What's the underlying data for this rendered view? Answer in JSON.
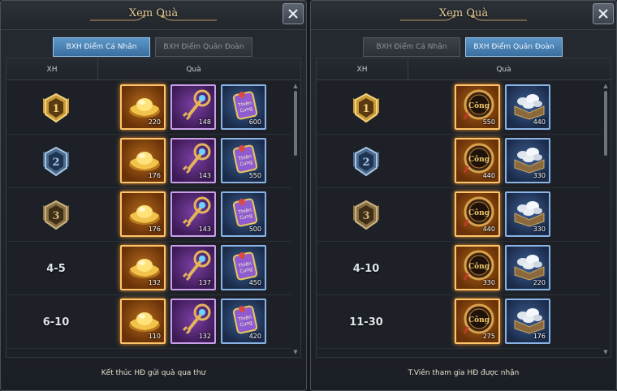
{
  "left": {
    "title": "Xem Quà",
    "tabs": [
      "BXH Điểm Cá Nhân",
      "BXH Điểm Quân Đoàn"
    ],
    "active_tab": 0,
    "columns": {
      "rank": "XH",
      "rewards": "Quà"
    },
    "rows": [
      {
        "rank": "1",
        "rank_type": "gold-badge",
        "items": [
          {
            "icon": "gold-ingot-icon",
            "qty": "220"
          },
          {
            "icon": "gem-key-icon",
            "qty": "148"
          },
          {
            "icon": "thien-cung-ticket-icon",
            "qty": "600"
          }
        ]
      },
      {
        "rank": "2",
        "rank_type": "silver-badge",
        "items": [
          {
            "icon": "gold-ingot-icon",
            "qty": "176"
          },
          {
            "icon": "gem-key-icon",
            "qty": "143"
          },
          {
            "icon": "thien-cung-ticket-icon",
            "qty": "550"
          }
        ]
      },
      {
        "rank": "3",
        "rank_type": "bronze-badge",
        "items": [
          {
            "icon": "gold-ingot-icon",
            "qty": "176"
          },
          {
            "icon": "gem-key-icon",
            "qty": "143"
          },
          {
            "icon": "thien-cung-ticket-icon",
            "qty": "500"
          }
        ]
      },
      {
        "rank": "4-5",
        "rank_type": "text",
        "items": [
          {
            "icon": "gold-ingot-icon",
            "qty": "132"
          },
          {
            "icon": "gem-key-icon",
            "qty": "137"
          },
          {
            "icon": "thien-cung-ticket-icon",
            "qty": "450"
          }
        ]
      },
      {
        "rank": "6-10",
        "rank_type": "text",
        "items": [
          {
            "icon": "gold-ingot-icon",
            "qty": "110"
          },
          {
            "icon": "gem-key-icon",
            "qty": "132"
          },
          {
            "icon": "thien-cung-ticket-icon",
            "qty": "420"
          }
        ]
      }
    ],
    "footer": "Kết thúc HĐ gửi quà qua thư"
  },
  "right": {
    "title": "Xem Quà",
    "tabs": [
      "BXH Điểm Cá Nhân",
      "BXH Điểm Quân Đoàn"
    ],
    "active_tab": 1,
    "columns": {
      "rank": "XH",
      "rewards": "Quà"
    },
    "rows": [
      {
        "rank": "1",
        "rank_type": "gold-badge",
        "items": [
          {
            "icon": "cong-medal-icon",
            "qty": "550"
          },
          {
            "icon": "silver-crate-icon",
            "qty": "440"
          }
        ]
      },
      {
        "rank": "2",
        "rank_type": "silver-badge",
        "items": [
          {
            "icon": "cong-medal-icon",
            "qty": "440"
          },
          {
            "icon": "silver-crate-icon",
            "qty": "330"
          }
        ]
      },
      {
        "rank": "3",
        "rank_type": "bronze-badge",
        "items": [
          {
            "icon": "cong-medal-icon",
            "qty": "440"
          },
          {
            "icon": "silver-crate-icon",
            "qty": "330"
          }
        ]
      },
      {
        "rank": "4-10",
        "rank_type": "text",
        "items": [
          {
            "icon": "cong-medal-icon",
            "qty": "330"
          },
          {
            "icon": "silver-crate-icon",
            "qty": "220"
          }
        ]
      },
      {
        "rank": "11-30",
        "rank_type": "text",
        "items": [
          {
            "icon": "cong-medal-icon",
            "qty": "275"
          },
          {
            "icon": "silver-crate-icon",
            "qty": "176"
          }
        ]
      }
    ],
    "footer": "T.Viên tham gia HĐ được nhận"
  },
  "icon_text": {
    "thien_cung": "Thiên Cung",
    "cong": "Công"
  },
  "colors": {
    "accent_blue": "#4a84b8",
    "title_gold": "#e8d2a0",
    "gold_frame": "#ffc56a"
  }
}
